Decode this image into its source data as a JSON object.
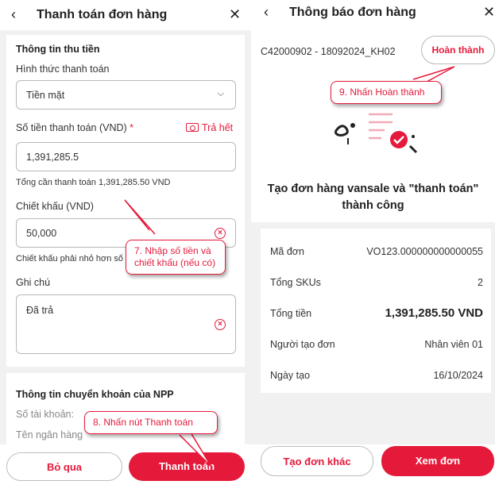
{
  "payment": {
    "title": "Thanh toán đơn hàng",
    "section_title": "Thông tin thu tiền",
    "method_label": "Hình thức thanh toán",
    "method_value": "Tiền mặt",
    "amount_label": "Số tiền thanh toán (VND)",
    "required_mark": "*",
    "pay_all": "Trả hết",
    "amount_value": "1,391,285.5",
    "amount_hint": "Tổng cần thanh toán 1,391,285.50 VND",
    "discount_label": "Chiết khấu (VND)",
    "discount_value": "50,000",
    "discount_hint": "Chiết khấu phải nhỏ hơn số",
    "note_label": "Ghi chú",
    "note_value": "Đã trả",
    "transfer_title": "Thông tin chuyển khoản của NPP",
    "account_label": "Số tài khoản:",
    "bank_label": "Tên ngân hàng",
    "skip_label": "Bỏ qua",
    "pay_label": "Thanh toán"
  },
  "notice": {
    "title": "Thông báo đơn hàng",
    "order_code": "C42000902 - 18092024_KH02",
    "done_label": "Hoàn thành",
    "success_line1": "Tạo đơn hàng vansale và \"thanh toán\"",
    "success_line2": "thành công",
    "rows": [
      {
        "key": "Mã đơn",
        "value": "VO123.000000000000055"
      },
      {
        "key": "Tổng SKUs",
        "value": "2"
      },
      {
        "key": "Tổng tiền",
        "value": "1,391,285.50 VND"
      },
      {
        "key": "Người tạo đơn",
        "value": "Nhân viên 01"
      },
      {
        "key": "Ngày tạo",
        "value": "16/10/2024"
      }
    ],
    "new_order_label": "Tạo đơn khác",
    "view_order_label": "Xem đơn"
  },
  "callouts": {
    "step7_line1": "7. Nhập số tiền và",
    "step7_line2": "chiết khấu (nếu có)",
    "step8": "8. Nhấn nút Thanh toán",
    "step9": "9. Nhấn Hoàn thành"
  },
  "colors": {
    "accent": "#e51a3b",
    "background": "#f1f1f1"
  }
}
